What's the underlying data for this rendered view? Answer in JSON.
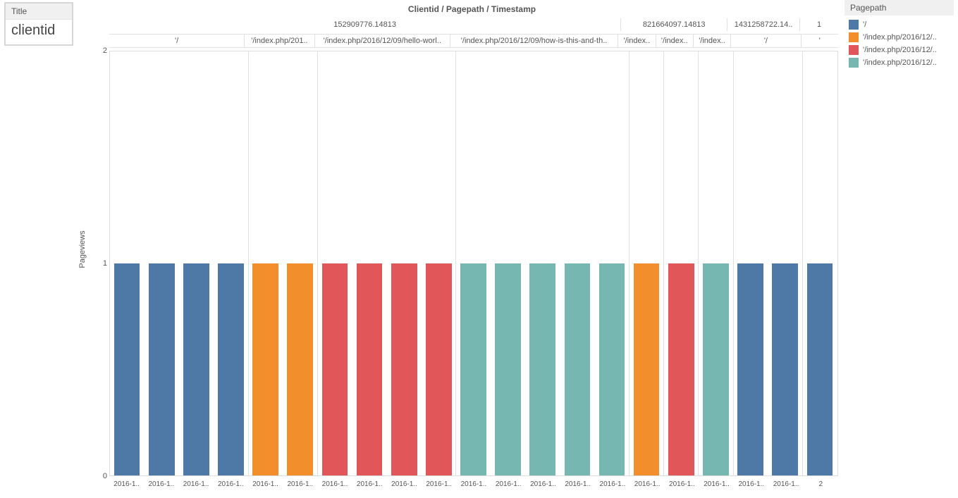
{
  "title_card": {
    "label": "Title",
    "value": "clientid"
  },
  "chart_title": "Clientid / Pagepath / Timestamp",
  "legend": {
    "title": "Pagepath",
    "items": [
      {
        "color": "#4E79A7",
        "label": "'/"
      },
      {
        "color": "#F28E2B",
        "label": "'/index.php/2016/12/.."
      },
      {
        "color": "#E15759",
        "label": "'/index.php/2016/12/.."
      },
      {
        "color": "#76B7B2",
        "label": "'/index.php/2016/12/.."
      }
    ]
  },
  "yaxis": {
    "label": "Pageviews",
    "ticks": [
      0,
      1,
      2
    ],
    "min": 0,
    "max": 2
  },
  "chart_data": {
    "type": "bar",
    "ylabel": "Pageviews",
    "xlabel": "",
    "title": "Clientid / Pagepath / Timestamp",
    "ylim": [
      0,
      2
    ],
    "hierarchy": [
      {
        "level": "Clientid",
        "groups": [
          {
            "label": "152909776.14813",
            "span": 15
          },
          {
            "label": "821664097.14813",
            "span": 3
          },
          {
            "label": "1431258722.14..",
            "span": 2
          },
          {
            "label": "1",
            "span": 1
          }
        ]
      },
      {
        "level": "Pagepath",
        "groups": [
          {
            "label": "'/",
            "span": 4
          },
          {
            "label": "'/index.php/201..",
            "span": 2
          },
          {
            "label": "'/index.php/2016/12/09/hello-worl..",
            "span": 4
          },
          {
            "label": "'/index.php/2016/12/09/how-is-this-and-th..",
            "span": 5
          },
          {
            "label": "'/index..",
            "span": 1
          },
          {
            "label": "'/index..",
            "span": 1
          },
          {
            "label": "'/index..",
            "span": 1
          },
          {
            "label": "'/",
            "span": 2
          },
          {
            "label": "'",
            "span": 1
          }
        ]
      }
    ],
    "bars": [
      {
        "x": "2016-1..",
        "value": 1,
        "color": "#4E79A7"
      },
      {
        "x": "2016-1..",
        "value": 1,
        "color": "#4E79A7"
      },
      {
        "x": "2016-1..",
        "value": 1,
        "color": "#4E79A7"
      },
      {
        "x": "2016-1..",
        "value": 1,
        "color": "#4E79A7"
      },
      {
        "x": "2016-1..",
        "value": 1,
        "color": "#F28E2B"
      },
      {
        "x": "2016-1..",
        "value": 1,
        "color": "#F28E2B"
      },
      {
        "x": "2016-1..",
        "value": 1,
        "color": "#E15759"
      },
      {
        "x": "2016-1..",
        "value": 1,
        "color": "#E15759"
      },
      {
        "x": "2016-1..",
        "value": 1,
        "color": "#E15759"
      },
      {
        "x": "2016-1..",
        "value": 1,
        "color": "#E15759"
      },
      {
        "x": "2016-1..",
        "value": 1,
        "color": "#76B7B2"
      },
      {
        "x": "2016-1..",
        "value": 1,
        "color": "#76B7B2"
      },
      {
        "x": "2016-1..",
        "value": 1,
        "color": "#76B7B2"
      },
      {
        "x": "2016-1..",
        "value": 1,
        "color": "#76B7B2"
      },
      {
        "x": "2016-1..",
        "value": 1,
        "color": "#76B7B2"
      },
      {
        "x": "2016-1..",
        "value": 1,
        "color": "#F28E2B"
      },
      {
        "x": "2016-1..",
        "value": 1,
        "color": "#E15759"
      },
      {
        "x": "2016-1..",
        "value": 1,
        "color": "#76B7B2"
      },
      {
        "x": "2016-1..",
        "value": 1,
        "color": "#4E79A7"
      },
      {
        "x": "2016-1..",
        "value": 1,
        "color": "#4E79A7"
      },
      {
        "x": "2",
        "value": 1,
        "color": "#4E79A7"
      }
    ]
  }
}
